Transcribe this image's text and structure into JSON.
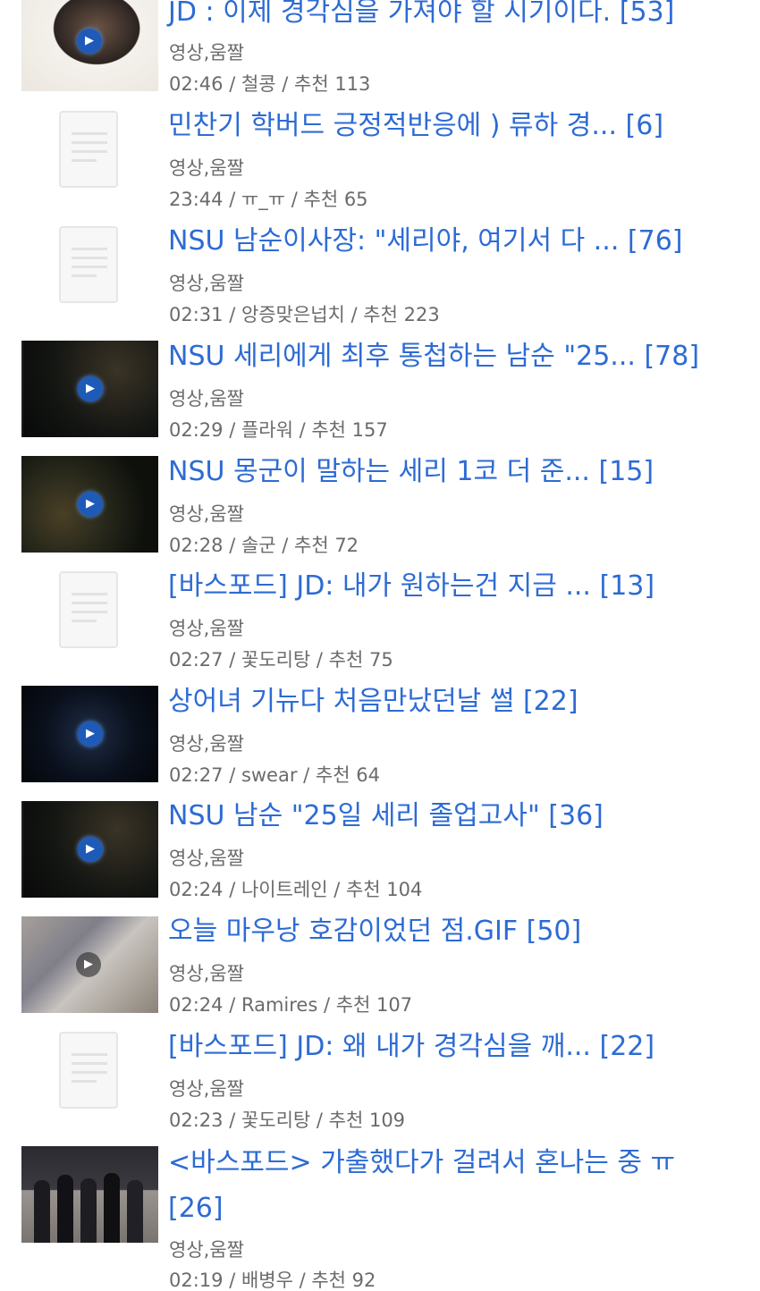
{
  "posts": [
    {
      "title": "JD : 이제 경각심을 가져야 할 시기이다. [53]",
      "category": "영상,움짤",
      "meta": "02:46 / 철콩 / 추천 113",
      "thumb": "person-video-thumbnail"
    },
    {
      "title": "민찬기 학버드 긍정적반응에 ) 류하 경... [6]",
      "category": "영상,움짤",
      "meta": "23:44 / ㅠ_ㅠ / 추천 65",
      "thumb": "document-placeholder"
    },
    {
      "title": "NSU 남순이사장: \"세리야, 여기서 다 ... [76]",
      "category": "영상,움짤",
      "meta": "02:31 / 앙증맞은넙치 / 추천 223",
      "thumb": "document-placeholder"
    },
    {
      "title": "NSU 세리에게 최후 통첩하는 남순 \"25... [78]",
      "category": "영상,움짤",
      "meta": "02:29 / 플라워 / 추천 157",
      "thumb": "game-video-thumbnail"
    },
    {
      "title": "NSU 몽군이 말하는 세리 1코 더 준... [15]",
      "category": "영상,움짤",
      "meta": "02:28 / 솔군 / 추천 72",
      "thumb": "game-video-thumbnail"
    },
    {
      "title": "[바스포드] JD: 내가 원하는건 지금 ... [13]",
      "category": "영상,움짤",
      "meta": "02:27 / 꽃도리탕 / 추천 75",
      "thumb": "document-placeholder"
    },
    {
      "title": "상어녀 기뉴다 처음만났던날 썰 [22]",
      "category": "영상,움짤",
      "meta": "02:27 / swear / 추천 64",
      "thumb": "space-video-thumbnail"
    },
    {
      "title": "NSU 남순 \"25일 세리 졸업고사\" [36]",
      "category": "영상,움짤",
      "meta": "02:24 / 나이트레인 / 추천 104",
      "thumb": "game-video-thumbnail"
    },
    {
      "title": "오늘 마우낭 호감이었던 점.GIF [50]",
      "category": "영상,움짤",
      "meta": "02:24 / Ramires / 추천 107",
      "thumb": "gif-video-thumbnail"
    },
    {
      "title": "[바스포드] JD: 왜 내가 경각심을 깨... [22]",
      "category": "영상,움짤",
      "meta": "02:23 / 꽃도리탕 / 추천 109",
      "thumb": "document-placeholder"
    },
    {
      "title": "<바스포드> 가출했다가 걸려서 혼나는 중 ㅠ [26]",
      "category": "영상,움짤",
      "meta": "02:19 / 배병우 / 추천 92",
      "thumb": "group-photo-thumbnail"
    }
  ],
  "colors": {
    "title_link": "#2d6bd4",
    "meta_text": "#6b6b6b",
    "background": "#ffffff"
  }
}
